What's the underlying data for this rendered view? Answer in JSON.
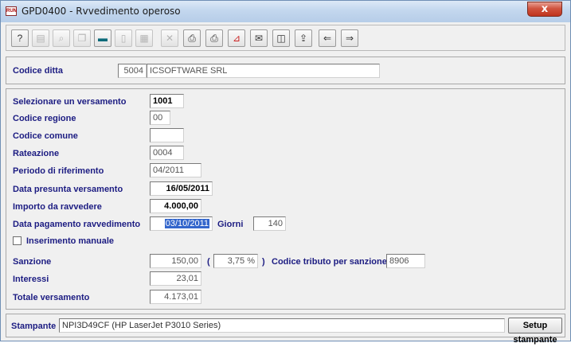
{
  "window": {
    "title": "GPD0400 - Rvvedimento operoso",
    "icon_label": "RUN",
    "close_label": "x"
  },
  "toolbar": {
    "buttons": [
      {
        "name": "help-icon",
        "glyph": "?"
      },
      {
        "name": "properties-icon",
        "glyph": "▤"
      },
      {
        "name": "binoculars-icon",
        "glyph": "⌕"
      },
      {
        "name": "copy-icon",
        "glyph": "❐"
      },
      {
        "name": "screen-icon",
        "glyph": "▬"
      },
      {
        "name": "page-icon",
        "glyph": "▯"
      },
      {
        "name": "grid-icon",
        "glyph": "▦"
      },
      {
        "name": "delete-icon",
        "glyph": "✕"
      },
      {
        "name": "preview-icon",
        "glyph": "⎙"
      },
      {
        "name": "printer-icon",
        "glyph": "⎙"
      },
      {
        "name": "pdf-icon",
        "glyph": "⊿"
      },
      {
        "name": "email-icon",
        "glyph": "✉"
      },
      {
        "name": "folder-icon",
        "glyph": "◫"
      },
      {
        "name": "export-icon",
        "glyph": "⇪"
      },
      {
        "name": "arrow-left-icon",
        "glyph": "⇐"
      },
      {
        "name": "arrow-right-icon",
        "glyph": "⇒"
      }
    ]
  },
  "company": {
    "label": "Codice ditta",
    "code": "5004",
    "name": "ICSOFTWARE SRL"
  },
  "form": {
    "versamento_label": "Selezionare un versamento",
    "versamento_value": "1001",
    "regione_label": "Codice regione",
    "regione_value": "00",
    "comune_label": "Codice comune",
    "comune_value": "",
    "rateazione_label": "Rateazione",
    "rateazione_value": "0004",
    "periodo_label": "Periodo di riferimento",
    "periodo_value": "04/2011",
    "data_presunta_label": "Data presunta versamento",
    "data_presunta_value": "16/05/2011",
    "importo_label": "Importo da ravvedere",
    "importo_value": "4.000,00",
    "data_pagamento_label": "Data pagamento ravvedimento",
    "data_pagamento_value": "03/10/2011",
    "giorni_label": "Giorni",
    "giorni_value": "140",
    "inserimento_label": "Inserimento manuale",
    "inserimento_checked": false
  },
  "totals": {
    "sanzione_label": "Sanzione",
    "sanzione_value": "150,00",
    "open_paren": "(",
    "percent_value": "3,75 %",
    "close_paren": ")",
    "codice_tributo_label": "Codice tributo per sanzione",
    "codice_tributo_value": "8906",
    "interessi_label": "Interessi",
    "interessi_value": "23,01",
    "totale_label": "Totale versamento",
    "totale_value": "4.173,01"
  },
  "printer": {
    "label": "Stampante",
    "value": "NPI3D49CF (HP LaserJet P3010 Series)",
    "setup_label": "Setup stampante"
  }
}
